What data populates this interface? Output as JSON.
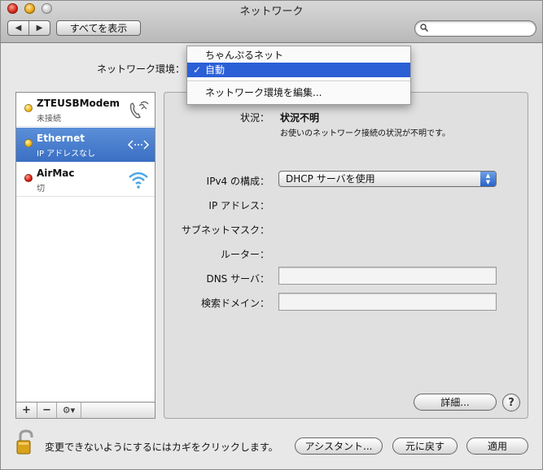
{
  "window": {
    "title": "ネットワーク"
  },
  "toolbar": {
    "show_all": "すべてを表示",
    "back": "◀",
    "forward": "▶",
    "search_placeholder": ""
  },
  "location": {
    "label": "ネットワーク環境：",
    "menu": [
      {
        "label": "ちゃんぷるネット"
      },
      {
        "label": "自動",
        "check": "✓"
      },
      {
        "label": "ネットワーク環境を編集..."
      }
    ]
  },
  "services": [
    {
      "name": "ZTEUSBModem",
      "status": "未接続",
      "dot": "yellow",
      "icon": "phone-modem-icon"
    },
    {
      "name": "Ethernet",
      "status": "IP アドレスなし",
      "dot": "yellow",
      "icon": "ethernet-arrows-icon"
    },
    {
      "name": "AirMac",
      "status": "切",
      "dot": "red",
      "icon": "wifi-icon"
    }
  ],
  "list_buttons": {
    "add": "+",
    "remove": "−",
    "action": "⚙▾"
  },
  "detail": {
    "status_label": "状況：",
    "status_value": "状況不明",
    "status_desc": "お使いのネットワーク接続の状況が不明です。",
    "ipv4_label": "IPv4 の構成：",
    "ipv4_value": "DHCP サーバを使用",
    "ip_label": "IP アドレス：",
    "subnet_label": "サブネットマスク：",
    "router_label": "ルーター：",
    "dns_label": "DNS サーバ：",
    "search_label": "検索ドメイン：",
    "dns_value": "",
    "search_value": "",
    "advanced": "詳細...",
    "help": "?"
  },
  "footer": {
    "lock_text": "変更できないようにするにはカギをクリックします。",
    "assistant": "アシスタント...",
    "revert": "元に戻す",
    "apply": "適用"
  },
  "colors": {
    "selection": "#2b5fd6",
    "selected_row": "#3a6fc4"
  }
}
